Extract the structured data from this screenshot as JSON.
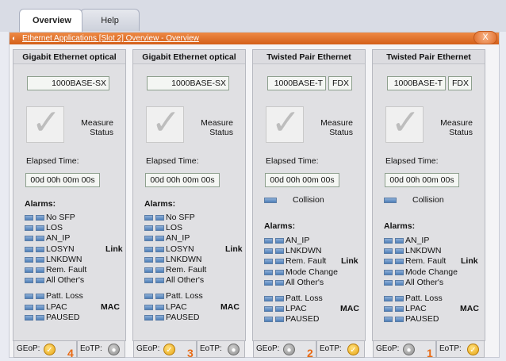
{
  "tabs": [
    "Overview",
    "Help"
  ],
  "window": {
    "title": "Ethernet Applications [Slot 2] Overview - Overview",
    "close": "X"
  },
  "measure_label": "Measure\nStatus",
  "elapsed_label": "Elapsed Time:",
  "elapsed_value": "00d 00h 00m 00s",
  "alarms_label": "Alarms:",
  "collision_label": "Collision",
  "geop_label": "GEoP:",
  "eotp_label": "EoTP:",
  "columns": [
    {
      "header": "Gigabit Ethernet optical",
      "mode": "1000BASE-SX",
      "duplex": "",
      "alarms_a": [
        "No SFP",
        "LOS",
        "AN_IP",
        "LOSYN",
        "LNKDWN",
        "Rem. Fault",
        "All Other's"
      ],
      "link_label": "Link",
      "alarms_b": [
        "Patt. Loss",
        "LPAC",
        "PAUSED"
      ],
      "mac_label": "MAC",
      "slot": "4",
      "geop_state": "on",
      "eotp_state": "off"
    },
    {
      "header": "Gigabit Ethernet optical",
      "mode": "1000BASE-SX",
      "duplex": "",
      "alarms_a": [
        "No SFP",
        "LOS",
        "AN_IP",
        "LOSYN",
        "LNKDWN",
        "Rem. Fault",
        "All Other's"
      ],
      "link_label": "Link",
      "alarms_b": [
        "Patt. Loss",
        "LPAC",
        "PAUSED"
      ],
      "mac_label": "MAC",
      "slot": "3",
      "geop_state": "on",
      "eotp_state": "off"
    },
    {
      "header": "Twisted Pair Ethernet",
      "mode": "1000BASE-T",
      "duplex": "FDX",
      "alarms_a": [
        "AN_IP",
        "LNKDWN",
        "Rem. Fault",
        "Mode Change",
        "All Other's"
      ],
      "link_label": "Link",
      "alarms_b": [
        "Patt. Loss",
        "LPAC",
        "PAUSED"
      ],
      "mac_label": "MAC",
      "slot": "2",
      "geop_state": "off",
      "eotp_state": "on"
    },
    {
      "header": "Twisted Pair Ethernet",
      "mode": "1000BASE-T",
      "duplex": "FDX",
      "alarms_a": [
        "AN_IP",
        "LNKDWN",
        "Rem. Fault",
        "Mode Change",
        "All Other's"
      ],
      "link_label": "Link",
      "alarms_b": [
        "Patt. Loss",
        "LPAC",
        "PAUSED"
      ],
      "mac_label": "MAC",
      "slot": "1",
      "geop_state": "off",
      "eotp_state": "on"
    }
  ]
}
